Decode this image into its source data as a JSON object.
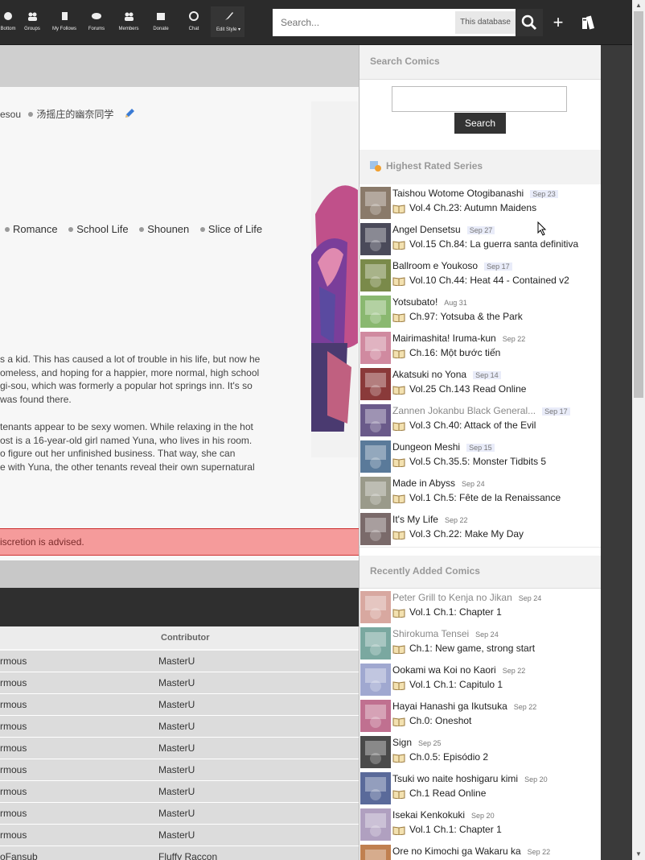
{
  "nav": {
    "items": [
      {
        "label": "Bottom",
        "icon": "question-icon"
      },
      {
        "label": "Groups",
        "icon": "groups-icon"
      },
      {
        "label": "My Follows",
        "icon": "bookmark-icon"
      },
      {
        "label": "Forums",
        "icon": "forums-icon"
      },
      {
        "label": "Members",
        "icon": "members-icon"
      },
      {
        "label": "Donate",
        "icon": "donate-icon"
      },
      {
        "label": "Chat",
        "icon": "chat-icon"
      },
      {
        "label": "Edit Style ▾",
        "icon": "brush-icon"
      }
    ],
    "search_placeholder": "Search...",
    "search_scope": "This database",
    "plus": "+"
  },
  "main": {
    "alt_titles": [
      "esou",
      "汤摇庄的幽奈同学"
    ],
    "genres": [
      "Romance",
      "School Life",
      "Shounen",
      "Slice of Life"
    ],
    "description_p1": [
      "s a kid. This has caused a lot of trouble in his life, but now he",
      "omeless, and hoping for a happier, more normal, high school",
      "gi-sou, which was formerly a popular hot springs inn. It's so",
      " was found there."
    ],
    "description_p2": [
      "tenants appear to be sexy women. While relaxing in the hot",
      "ost is a 16-year-old girl named Yuna, who lives in his room.",
      "o figure out her unfinished business. That way, she can",
      "e with Yuna, the other tenants reveal their own supernatural"
    ],
    "warning": "iscretion is advised.",
    "table": {
      "contributor_header": "Contributor",
      "rows": [
        {
          "group": "rmous",
          "contributor": "MasterU"
        },
        {
          "group": "rmous",
          "contributor": "MasterU"
        },
        {
          "group": "rmous",
          "contributor": "MasterU"
        },
        {
          "group": "rmous",
          "contributor": "MasterU"
        },
        {
          "group": "rmous",
          "contributor": "MasterU"
        },
        {
          "group": "rmous",
          "contributor": "MasterU"
        },
        {
          "group": "rmous",
          "contributor": "MasterU"
        },
        {
          "group": "rmous",
          "contributor": "MasterU"
        },
        {
          "group": "rmous",
          "contributor": "MasterU"
        },
        {
          "group": "oFansub",
          "contributor": "Fluffy Raccon"
        }
      ]
    }
  },
  "panel": {
    "search_title": "Search Comics",
    "search_button": "Search",
    "highest_title": "Highest Rated Series",
    "highest": [
      {
        "title": "Taishou Wotome Otogibanashi",
        "date": "Sep 23",
        "chapter": "Vol.4 Ch.23: Autumn Maidens",
        "color": "#8a7a6a"
      },
      {
        "title": "Angel Densetsu",
        "date": "Sep 27",
        "chapter": "Vol.15 Ch.84: La guerra santa definitiva",
        "color": "#4a4a5a"
      },
      {
        "title": "Ballroom e Youkoso",
        "date": "Sep 17",
        "chapter": "Vol.10 Ch.44: Heat 44 - Contained v2",
        "color": "#7a8a4a"
      },
      {
        "title": "Yotsubato!",
        "date": "Aug 31",
        "chapter": "Ch.97: Yotsuba & the Park",
        "color": "#8ab870"
      },
      {
        "title": "Mairimashita! Iruma-kun",
        "date": "Sep 22",
        "chapter": "Ch.16: Một bước tiến",
        "color": "#d08aa0"
      },
      {
        "title": "Akatsuki no Yona",
        "date": "Sep 14",
        "chapter": "Vol.25 Ch.143 Read Online",
        "color": "#8a3a3a"
      },
      {
        "title": "Zannen Jokanbu Black General...",
        "date": "Sep 17",
        "chapter": "Vol.3 Ch.40: Attack of the Evil",
        "color": "#6a5a8a"
      },
      {
        "title": "Dungeon Meshi",
        "date": "Sep 15",
        "chapter": "Vol.5 Ch.35.5: Monster Tidbits 5",
        "color": "#5a7a9a"
      },
      {
        "title": "Made in Abyss",
        "date": "Sep 24",
        "chapter": "Vol.1 Ch.5: Fête de la Renaissance",
        "color": "#9a9a8a"
      },
      {
        "title": "It's My Life",
        "date": "Sep 22",
        "chapter": "Vol.3 Ch.22: Make My Day",
        "color": "#7a6a6a"
      }
    ],
    "recent_title": "Recently Added Comics",
    "recent": [
      {
        "title": "Peter Grill to Kenja no Jikan",
        "date": "Sep 24",
        "chapter": "Vol.1 Ch.1: Chapter 1",
        "color": "#d8a8a0"
      },
      {
        "title": "Shirokuma Tensei",
        "date": "Sep 24",
        "chapter": "Ch.1: New game, strong start",
        "color": "#7aa8a0"
      },
      {
        "title": "Ookami wa Koi no Kaori",
        "date": "Sep 22",
        "chapter": "Vol.1 Ch.1: Capitulo 1",
        "color": "#a0a8d0"
      },
      {
        "title": "Hayai Hanashi ga Ikutsuka",
        "date": "Sep 22",
        "chapter": "Ch.0: Oneshot",
        "color": "#c07090"
      },
      {
        "title": "Sign",
        "date": "Sep 25",
        "chapter": "Ch.0.5: Episódio 2",
        "color": "#4a4a4a"
      },
      {
        "title": "Tsuki wo naite hoshigaru kimi",
        "date": "Sep 20",
        "chapter": "Ch.1 Read Online",
        "color": "#5a6a9a"
      },
      {
        "title": "Isekai Kenkokuki",
        "date": "Sep 20",
        "chapter": "Vol.1 Ch.1: Chapter 1",
        "color": "#b0a0c0"
      },
      {
        "title": "Ore no Kimochi ga Wakaru ka",
        "date": "Sep 22",
        "chapter": "",
        "color": "#c08050"
      }
    ]
  }
}
